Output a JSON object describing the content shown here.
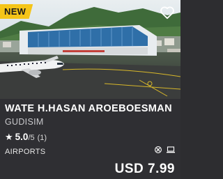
{
  "card": {
    "badge": "NEW",
    "title": "WATE H.HASAN AROEBOESMAN",
    "publisher": "GUDISIM",
    "rating": {
      "score": "5.0",
      "out_of": "/5",
      "count": "(1)",
      "star_icon": "star-icon"
    },
    "category": "AIRPORTS",
    "platform_icons": [
      "xbox-icon",
      "pc-icon"
    ],
    "price": "USD 7.99",
    "wishlist_icon": "heart-icon"
  },
  "colors": {
    "badge": "#f5c518",
    "card_bg": "#2f2f33",
    "sky": "#cfe3f0",
    "mountain": "#3f6b3a"
  }
}
